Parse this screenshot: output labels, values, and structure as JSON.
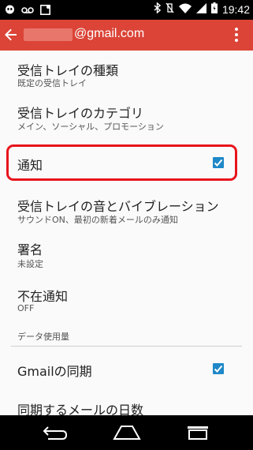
{
  "status_bar": {
    "time": "19:42",
    "battery_level": 1.0,
    "icons": [
      "hangouts-icon",
      "voicemail-icon",
      "notification-icon",
      "bluetooth-icon",
      "vibrate-icon",
      "wifi-icon",
      "signal-icon",
      "battery-icon"
    ]
  },
  "app_bar": {
    "account": "@gmail.com",
    "background_color": "#db4437"
  },
  "settings": {
    "inbox_type": {
      "title": "受信トレイの種類",
      "summary": "既定の受信トレイ"
    },
    "inbox_categories": {
      "title": "受信トレイのカテゴリ",
      "summary": "メイン、ソーシャル、プロモーション"
    },
    "notifications": {
      "title": "通知",
      "checked": true
    },
    "sound_vibrate": {
      "title": "受信トレイの音とバイブレーション",
      "summary": "サウンドON、最初の新着メールのみ通知"
    },
    "signature": {
      "title": "署名",
      "summary": "未設定"
    },
    "vacation": {
      "title": "不在通知",
      "summary": "OFF"
    },
    "data_usage_header": "データ使用量",
    "gmail_sync": {
      "title": "Gmailの同期",
      "checked": true
    },
    "days_to_sync": {
      "title": "同期するメールの日数"
    }
  },
  "colors": {
    "accent": "#1e88c8",
    "highlight": "#e8141c"
  }
}
